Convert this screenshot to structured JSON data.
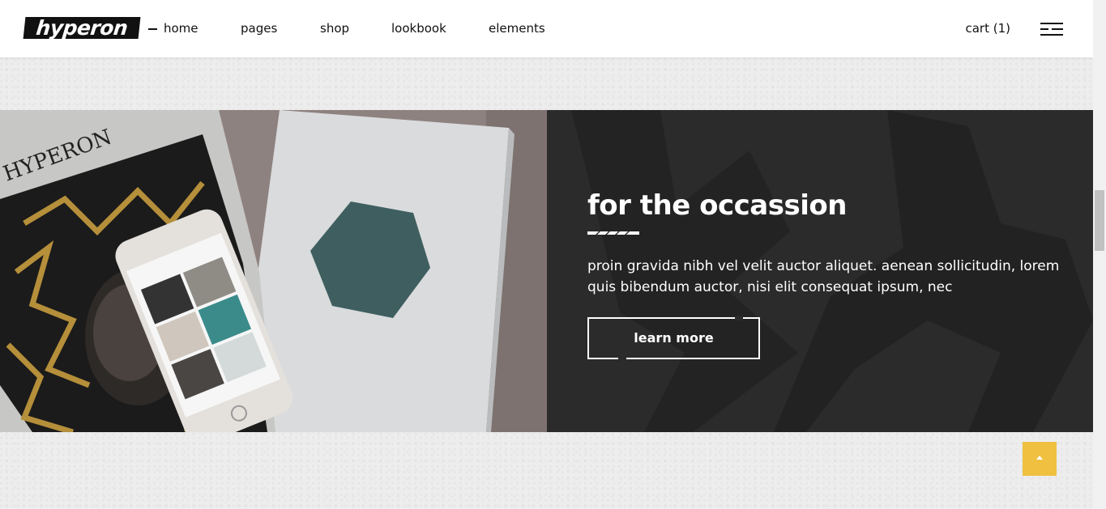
{
  "header": {
    "logo": "hyperon",
    "nav": [
      "home",
      "pages",
      "shop",
      "lookbook",
      "elements"
    ],
    "cart_label": "cart (1)"
  },
  "banner": {
    "photo_magazine_title": "HYPERON",
    "headline": "for the occassion",
    "body": "proin gravida nibh vel velit auctor aliquet. aenean sollicitudin, lorem quis bibendum auctor, nisi elit consequat ipsum, nec",
    "button_label": "learn more"
  },
  "colors": {
    "accent": "#f0c040",
    "panel": "#2b2b2b",
    "page_bg": "#ededed"
  },
  "icons": {
    "menu": "hamburger-menu-icon",
    "scroll_top": "arrow-up-icon"
  }
}
